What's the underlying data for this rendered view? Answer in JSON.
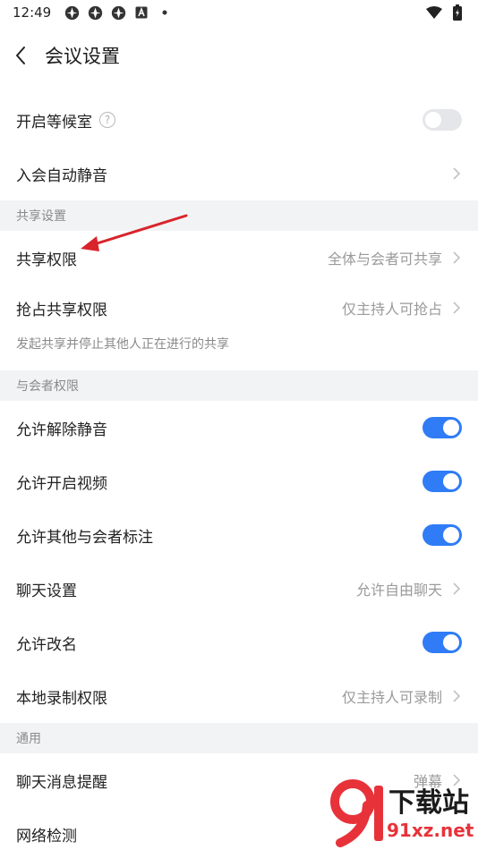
{
  "status": {
    "time": "12:49"
  },
  "nav": {
    "title": "会议设置"
  },
  "rows": {
    "waiting_room": "开启等候室",
    "auto_mute": "入会自动静音",
    "share_section": "共享设置",
    "share_permission": "共享权限",
    "share_permission_value": "全体与会者可共享",
    "grab_share": "抢占共享权限",
    "grab_share_value": "仅主持人可抢占",
    "grab_note": "发起共享并停止其他人正在进行的共享",
    "participant_section": "与会者权限",
    "allow_unmute": "允许解除静音",
    "allow_video": "允许开启视频",
    "allow_annotate": "允许其他与会者标注",
    "chat_settings": "聊天设置",
    "chat_settings_value": "允许自由聊天",
    "allow_rename": "允许改名",
    "local_record": "本地录制权限",
    "local_record_value": "仅主持人可录制",
    "general_section": "通用",
    "chat_reminder": "聊天消息提醒",
    "chat_reminder_value": "弹幕",
    "network_check": "网络检测"
  },
  "toggles": {
    "waiting_room": false,
    "allow_unmute": true,
    "allow_video": true,
    "allow_annotate": true,
    "allow_rename": true
  },
  "colors": {
    "accent": "#2f7cf6",
    "annotation": "#d9242b"
  },
  "watermark": {
    "text": "下载站",
    "domain": "91xz.net"
  }
}
